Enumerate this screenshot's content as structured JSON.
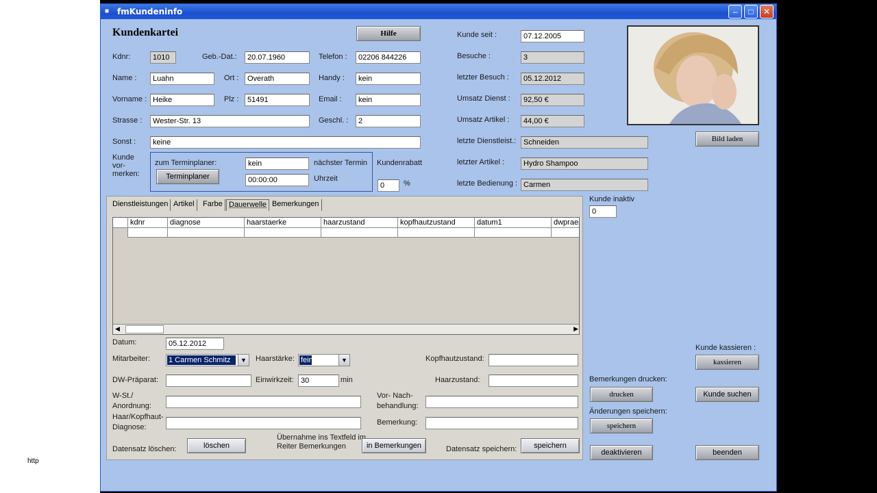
{
  "window": {
    "title": "fmKundeninfo"
  },
  "left_strip": {
    "text": "http"
  },
  "header": {
    "title": "Kundenkartei",
    "help_label": "Hilfe"
  },
  "customer": {
    "kdnr_label": "Kdnr:",
    "kdnr": "1010",
    "gebdat_label": "Geb.-Dat.:",
    "gebdat": "20.07.1960",
    "telefon_label": "Telefon :",
    "telefon": "02206 844226",
    "name_label": "Name :",
    "name": "Luahn",
    "ort_label": "Ort :",
    "ort": "Overath",
    "handy_label": "Handy :",
    "handy": "kein",
    "vorname_label": "Vorname :",
    "vorname": "Heike",
    "plz_label": "Plz :",
    "plz": "51491",
    "email_label": "Email :",
    "email": "kein",
    "strasse_label": "Strasse :",
    "strasse": "Wester-Str. 13",
    "geschl_label": "Geschl. :",
    "geschl": "2",
    "sonst_label": "Sonst :",
    "sonst": "keine"
  },
  "vormerken": {
    "label_line1": "Kunde",
    "label_line2": "vor-",
    "label_line3": "merken:",
    "terminplaner_label": "zum Terminplaner:",
    "terminplaner_button": "Terminplaner",
    "naechster_value": "kein",
    "naechster_label": "nächster Termin",
    "uhrzeit_value": "00:00:00",
    "uhrzeit_label": "Uhrzeit",
    "rabatt_label": "Kundenrabatt",
    "rabatt_value": "0",
    "rabatt_unit": "%"
  },
  "stats": {
    "kunde_seit_label": "Kunde seit :",
    "kunde_seit": "07.12.2005",
    "besuche_label": "Besuche :",
    "besuche": "3",
    "letzter_besuch_label": "letzter Besuch :",
    "letzter_besuch": "05.12.2012",
    "umsatz_dienst_label": "Umsatz Dienst :",
    "umsatz_dienst": "92,50 €",
    "umsatz_artikel_label": "Umsatz Artikel :",
    "umsatz_artikel": "44,00 €",
    "letzte_dienstl_label": "letzte Dienstleist.:",
    "letzte_dienstl": "Schneiden",
    "letzter_artikel_label": "letzter Artikel :",
    "letzter_artikel": "Hydro Shampoo",
    "letzte_bedienung_label": "letzte Bedienung :",
    "letzte_bedienung": "Carmen"
  },
  "photo": {
    "bild_laden": "Bild laden"
  },
  "inaktiv": {
    "label": "Kunde inaktiv",
    "value": "0"
  },
  "tabs": [
    "Dienstleistungen",
    "Artikel",
    "Farbe",
    "Dauerwelle",
    "Bemerkungen"
  ],
  "grid": {
    "columns": [
      "kdnr",
      "diagnose",
      "haarstaerke",
      "haarzustand",
      "kopfhautzustand",
      "datum1",
      "dwpraep"
    ]
  },
  "form": {
    "datum_label": "Datum:",
    "datum": "05.12.2012",
    "mitarbeiter_label": "Mitarbeiter:",
    "mitarbeiter": "1    Carmen Schmitz",
    "haarstaerke_label": "Haarstärke:",
    "haarstaerke": "fein",
    "kopfhaut_label": "Kopfhautzustand:",
    "dw_label": "DW-Präparat:",
    "einwirkzeit_label": "Einwirkzeit:",
    "einwirkzeit": "30",
    "einwirk_unit": "min",
    "haarzustand_label": "Haarzustand:",
    "wst_label1": "W-St./",
    "wst_label2": "Anordnung:",
    "vornach_label1": "Vor- Nach-",
    "vornach_label2": "behandlung:",
    "haar_label1": "Haar/Kopfhaut-",
    "haar_label2": "Diagnose:",
    "bemerkung_label": "Bemerkung:",
    "loeschen_label": "Datensatz löschen:",
    "loeschen_button": "löschen",
    "uebernahme_line1": "Übernahme ins Textfeld im",
    "uebernahme_line2": "Reiter Bemerkungen",
    "in_bemerkungen_button": "in Bemerkungen",
    "speichern_label": "Datensatz speichern:",
    "speichern_button": "speichern"
  },
  "right": {
    "kassieren_label": "Kunde kassieren :",
    "kassieren_button": "kassieren",
    "drucken_label": "Bemerkungen drucken:",
    "drucken_button": "drucken",
    "suchen_button": "Kunde suchen",
    "aenderungen_label": "Änderungen speichern:",
    "aenderungen_button": "speichern",
    "deaktivieren_button": "deaktivieren",
    "beenden_button": "beenden"
  }
}
